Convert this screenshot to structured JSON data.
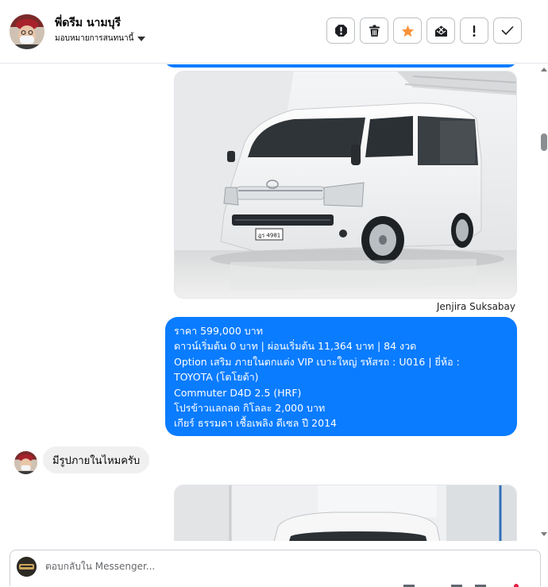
{
  "header": {
    "contact_name": "พี่ดรีม นามบุรี",
    "assign_label": "มอบหมายการสนทนานี้",
    "actions": [
      {
        "name": "mark-spam-button",
        "icon": "alert-octagon-icon"
      },
      {
        "name": "delete-button",
        "icon": "trash-icon"
      },
      {
        "name": "star-button",
        "icon": "star-icon",
        "color": "#f7923a"
      },
      {
        "name": "mark-unread-button",
        "icon": "envelope-x-icon"
      },
      {
        "name": "follow-up-button",
        "icon": "exclamation-icon"
      },
      {
        "name": "mark-done-button",
        "icon": "check-icon"
      }
    ]
  },
  "thread": {
    "sender_name": "Jenjira Suksabay",
    "outgoing_message_lines": [
      "ราคา 599,000 บาท",
      "ดาวน์เริ่มต้น 0 บาท | ผ่อนเริ่มต้น 11,364 บาท | 84 งวด",
      " Option เสริม ภายในตกแต่ง VIP เบาะใหญ่  รหัสรถ : U016 |  ยี่ห้อ :",
      "TOYOTA (โตโยต้า)",
      "Commuter D4D 2.5 (HRF)",
      " โปรข้าวแลกลด กิโลละ 2,000 บาท",
      " เกียร์ ธรรมดา  เชื้อเพลิง ดีเซล  ปี 2014"
    ],
    "incoming_message": "มีรูปภายในไหมครับ",
    "van_plate_text": "ฎร 4981"
  },
  "composer": {
    "placeholder": "ตอบกลับใน Messenger..."
  },
  "colors": {
    "outgoing_bubble": "#0a7cff",
    "incoming_bubble": "#f0f0f0",
    "star": "#f7923a"
  }
}
